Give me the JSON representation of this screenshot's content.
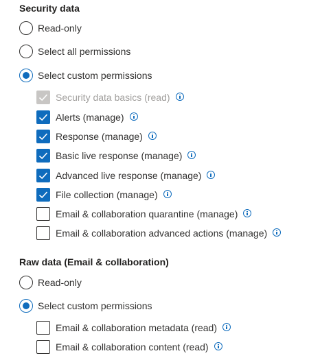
{
  "security_section": {
    "title": "Security data",
    "radios": [
      {
        "label": "Read-only",
        "checked": false
      },
      {
        "label": "Select all permissions",
        "checked": false
      },
      {
        "label": "Select custom permissions",
        "checked": true
      }
    ],
    "checkboxes": [
      {
        "label": "Security data basics (read)",
        "checked": true,
        "disabled": true,
        "info_icon": "info-icon"
      },
      {
        "label": "Alerts (manage)",
        "checked": true,
        "disabled": false,
        "info_icon": "info-icon"
      },
      {
        "label": "Response (manage)",
        "checked": true,
        "disabled": false,
        "info_icon": "info-icon"
      },
      {
        "label": "Basic live response (manage)",
        "checked": true,
        "disabled": false,
        "info_icon": "info-icon"
      },
      {
        "label": "Advanced live response (manage)",
        "checked": true,
        "disabled": false,
        "info_icon": "info-icon"
      },
      {
        "label": "File collection (manage)",
        "checked": true,
        "disabled": false,
        "info_icon": "info-icon"
      },
      {
        "label": "Email & collaboration quarantine (manage)",
        "checked": false,
        "disabled": false,
        "info_icon": "info-icon"
      },
      {
        "label": "Email & collaboration advanced actions (manage)",
        "checked": false,
        "disabled": false,
        "info_icon": "info-icon"
      }
    ]
  },
  "raw_section": {
    "title": "Raw data (Email & collaboration)",
    "radios": [
      {
        "label": "Read-only",
        "checked": false
      },
      {
        "label": "Select custom permissions",
        "checked": true
      }
    ],
    "checkboxes": [
      {
        "label": "Email & collaboration metadata (read)",
        "checked": false,
        "disabled": false,
        "info_icon": "info-icon"
      },
      {
        "label": "Email & collaboration content (read)",
        "checked": false,
        "disabled": false,
        "info_icon": "info-icon"
      }
    ]
  },
  "colors": {
    "accent": "#0f6cbd",
    "text": "#323130",
    "disabled_fill": "#c8c6c4",
    "disabled_text": "#a19f9d"
  }
}
